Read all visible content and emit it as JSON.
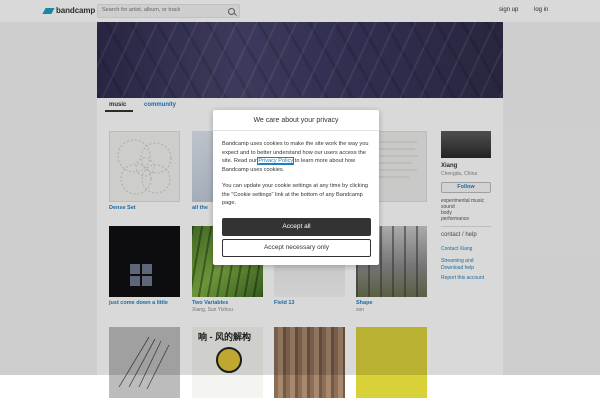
{
  "header": {
    "logo_text": "bandcamp",
    "search": {
      "placeholder": "Search for artist, album, or track"
    },
    "signup_label": "sign up",
    "login_label": "log in"
  },
  "tabs": {
    "music": "music",
    "community": "community"
  },
  "albums": [
    {
      "title": "Dense Set",
      "artist": ""
    },
    {
      "title": "all the",
      "artist": ""
    },
    {
      "title": "",
      "artist": ""
    },
    {
      "title": "n",
      "artist": ""
    },
    {
      "title": "just come down a little",
      "artist": ""
    },
    {
      "title": "Two Variables",
      "artist": "Xiang, Sun Yizhou"
    },
    {
      "title": "Field 13",
      "artist": ""
    },
    {
      "title": "Shape",
      "artist": "son"
    },
    {
      "title": "",
      "artist": ""
    },
    {
      "title": "",
      "artist": ""
    },
    {
      "title": "",
      "artist": ""
    },
    {
      "title": "",
      "artist": ""
    }
  ],
  "album_cover_text": "响 - 风的解构",
  "sidebar": {
    "artist_name": "Xiang",
    "location": "Chengdu, China",
    "follow_label": "Follow",
    "tags": [
      "experimental music",
      "sound",
      "body",
      "performance"
    ],
    "contact_heading": "contact / help",
    "links": [
      "Contact Xiang",
      "Streaming and Download help",
      "Report this account"
    ]
  },
  "cookie_modal": {
    "title": "We care about your privacy",
    "text_before_link": "Bandcamp uses cookies to make the site work the way you expect and to better understand how our users access the site. Read our ",
    "link_text": "Privacy Policy",
    "text_after_link": " to learn more about how Bandcamp uses cookies.",
    "paragraph2": "You can update your cookie settings at any time by clicking the \"Cookie settings\" link at the bottom of any Bandcamp page.",
    "accept_all_label": "Accept all",
    "accept_necessary_label": "Accept necessary only"
  },
  "colors": {
    "link_blue": "#1f7fbd",
    "logo_blue": "#1da0c3",
    "button_dark": "#333333"
  }
}
